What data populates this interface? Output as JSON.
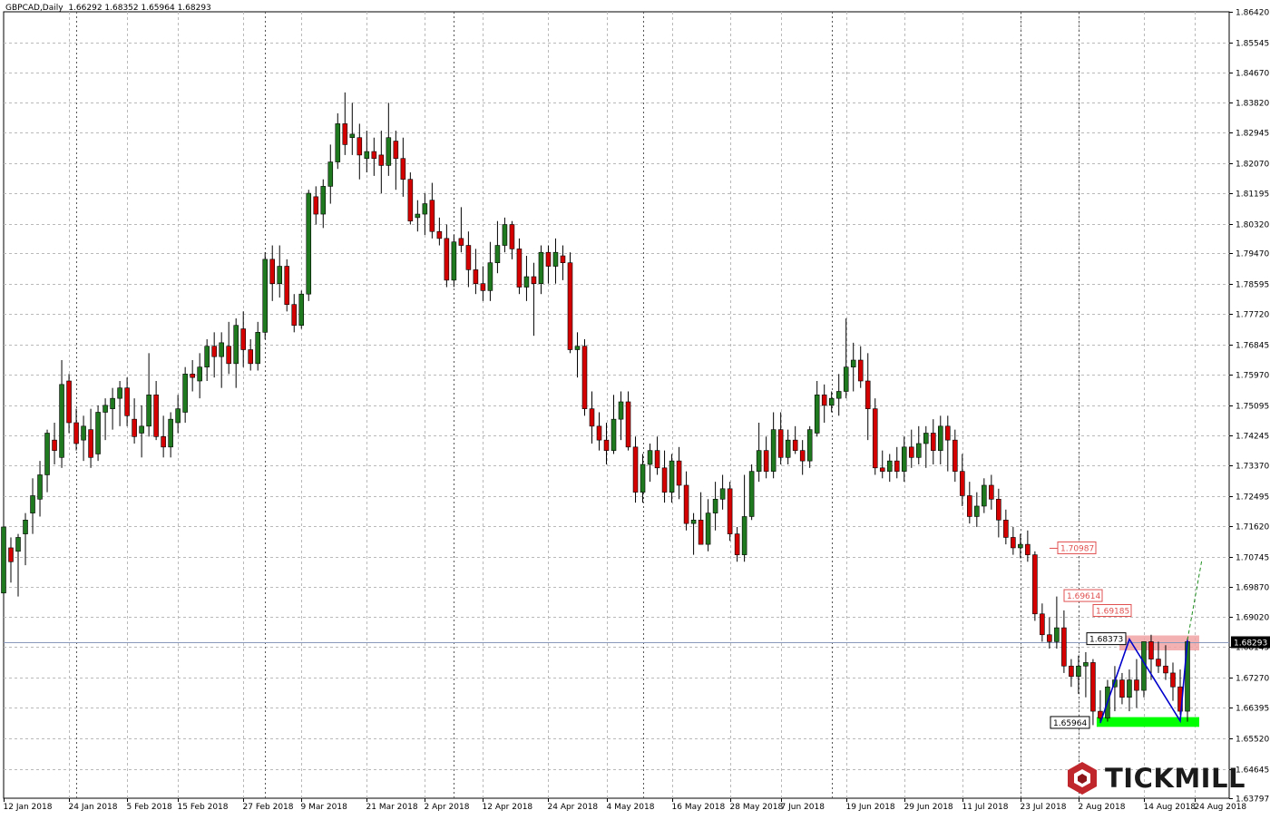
{
  "header": {
    "symbol": "GBPCAD,Daily",
    "ohlc": "1.66292 1.68352 1.65964 1.68293"
  },
  "logo": {
    "text": "TICKMILL",
    "icon": "hexagon-logo-icon",
    "color": "#c0272d"
  },
  "colors": {
    "bull": "#1f7a1f",
    "bear": "#d40000",
    "grid": "#b9b9b9",
    "support": "#00ff00",
    "resistance": "#f2a3a3",
    "pattern": "#0000cc",
    "projection": "#1f8f1f",
    "price_line": "#8899bb",
    "label_red": "#e05050"
  },
  "chart_data": {
    "type": "candlestick",
    "title": "GBPCAD,Daily",
    "ylim": [
      1.63797,
      1.8642
    ],
    "grid": true,
    "y_ticks": [
      "1.86420",
      "1.85545",
      "1.84670",
      "1.83820",
      "1.82945",
      "1.82070",
      "1.81195",
      "1.80320",
      "1.79470",
      "1.78595",
      "1.77720",
      "1.76845",
      "1.75970",
      "1.75095",
      "1.74245",
      "1.73370",
      "1.72495",
      "1.71620",
      "1.70745",
      "1.69870",
      "1.69020",
      "1.68145",
      "1.67270",
      "1.66395",
      "1.65520",
      "1.64645",
      "1.63797"
    ],
    "x_labels": [
      "12 Jan 2018",
      "24 Jan 2018",
      "5 Feb 2018",
      "15 Feb 2018",
      "27 Feb 2018",
      "9 Mar 2018",
      "21 Mar 2018",
      "2 Apr 2018",
      "12 Apr 2018",
      "24 Apr 2018",
      "4 May 2018",
      "16 May 2018",
      "28 May 2018",
      "7 Jun 2018",
      "19 Jun 2018",
      "29 Jun 2018",
      "11 Jul 2018",
      "23 Jul 2018",
      "2 Aug 2018",
      "14 Aug 2018",
      "24 Aug 2018"
    ],
    "candles": [
      [
        1.697,
        1.717,
        1.694,
        1.716
      ],
      [
        1.71,
        1.713,
        1.7,
        1.706
      ],
      [
        1.709,
        1.714,
        1.696,
        1.713
      ],
      [
        1.714,
        1.72,
        1.705,
        1.718
      ],
      [
        1.72,
        1.73,
        1.714,
        1.725
      ],
      [
        1.724,
        1.735,
        1.719,
        1.731
      ],
      [
        1.731,
        1.744,
        1.726,
        1.743
      ],
      [
        1.741,
        1.746,
        1.734,
        1.738
      ],
      [
        1.736,
        1.764,
        1.733,
        1.757
      ],
      [
        1.758,
        1.76,
        1.743,
        1.746
      ],
      [
        1.746,
        1.75,
        1.738,
        1.74
      ],
      [
        1.741,
        1.748,
        1.735,
        1.745
      ],
      [
        1.744,
        1.75,
        1.733,
        1.736
      ],
      [
        1.737,
        1.751,
        1.735,
        1.749
      ],
      [
        1.749,
        1.753,
        1.741,
        1.751
      ],
      [
        1.75,
        1.756,
        1.744,
        1.753
      ],
      [
        1.753,
        1.758,
        1.745,
        1.756
      ],
      [
        1.756,
        1.759,
        1.745,
        1.748
      ],
      [
        1.747,
        1.753,
        1.74,
        1.742
      ],
      [
        1.743,
        1.751,
        1.736,
        1.745
      ],
      [
        1.745,
        1.766,
        1.742,
        1.754
      ],
      [
        1.754,
        1.758,
        1.741,
        1.742
      ],
      [
        1.742,
        1.748,
        1.736,
        1.739
      ],
      [
        1.739,
        1.749,
        1.736,
        1.747
      ],
      [
        1.746,
        1.754,
        1.743,
        1.75
      ],
      [
        1.749,
        1.762,
        1.746,
        1.76
      ],
      [
        1.76,
        1.764,
        1.755,
        1.759
      ],
      [
        1.758,
        1.766,
        1.753,
        1.762
      ],
      [
        1.762,
        1.77,
        1.758,
        1.768
      ],
      [
        1.768,
        1.772,
        1.759,
        1.765
      ],
      [
        1.765,
        1.772,
        1.756,
        1.769
      ],
      [
        1.768,
        1.775,
        1.76,
        1.763
      ],
      [
        1.763,
        1.776,
        1.756,
        1.774
      ],
      [
        1.773,
        1.778,
        1.762,
        1.767
      ],
      [
        1.767,
        1.77,
        1.761,
        1.763
      ],
      [
        1.763,
        1.775,
        1.761,
        1.772
      ],
      [
        1.772,
        1.795,
        1.77,
        1.793
      ],
      [
        1.793,
        1.797,
        1.781,
        1.786
      ],
      [
        1.786,
        1.797,
        1.782,
        1.791
      ],
      [
        1.791,
        1.793,
        1.778,
        1.78
      ],
      [
        1.78,
        1.783,
        1.772,
        1.774
      ],
      [
        1.774,
        1.784,
        1.773,
        1.783
      ],
      [
        1.783,
        1.813,
        1.781,
        1.812
      ],
      [
        1.811,
        1.814,
        1.803,
        1.806
      ],
      [
        1.806,
        1.816,
        1.802,
        1.814
      ],
      [
        1.814,
        1.826,
        1.809,
        1.821
      ],
      [
        1.821,
        1.835,
        1.819,
        1.832
      ],
      [
        1.832,
        1.841,
        1.823,
        1.826
      ],
      [
        1.828,
        1.838,
        1.823,
        1.829
      ],
      [
        1.828,
        1.832,
        1.816,
        1.823
      ],
      [
        1.822,
        1.83,
        1.818,
        1.824
      ],
      [
        1.824,
        1.828,
        1.817,
        1.822
      ],
      [
        1.823,
        1.83,
        1.812,
        1.82
      ],
      [
        1.82,
        1.838,
        1.817,
        1.828
      ],
      [
        1.827,
        1.83,
        1.813,
        1.822
      ],
      [
        1.822,
        1.828,
        1.811,
        1.816
      ],
      [
        1.816,
        1.818,
        1.803,
        1.804
      ],
      [
        1.805,
        1.81,
        1.801,
        1.806
      ],
      [
        1.806,
        1.812,
        1.8,
        1.809
      ],
      [
        1.81,
        1.815,
        1.799,
        1.801
      ],
      [
        1.801,
        1.805,
        1.797,
        1.799
      ],
      [
        1.799,
        1.803,
        1.785,
        1.787
      ],
      [
        1.787,
        1.8,
        1.785,
        1.798
      ],
      [
        1.799,
        1.808,
        1.795,
        1.797
      ],
      [
        1.797,
        1.801,
        1.785,
        1.79
      ],
      [
        1.79,
        1.796,
        1.783,
        1.786
      ],
      [
        1.786,
        1.791,
        1.781,
        1.784
      ],
      [
        1.784,
        1.798,
        1.781,
        1.792
      ],
      [
        1.792,
        1.804,
        1.789,
        1.797
      ],
      [
        1.797,
        1.805,
        1.795,
        1.803
      ],
      [
        1.803,
        1.804,
        1.793,
        1.796
      ],
      [
        1.796,
        1.799,
        1.783,
        1.785
      ],
      [
        1.785,
        1.794,
        1.781,
        1.788
      ],
      [
        1.788,
        1.792,
        1.771,
        1.786
      ],
      [
        1.786,
        1.797,
        1.783,
        1.795
      ],
      [
        1.795,
        1.797,
        1.786,
        1.791
      ],
      [
        1.791,
        1.799,
        1.786,
        1.795
      ],
      [
        1.794,
        1.797,
        1.787,
        1.792
      ],
      [
        1.792,
        1.795,
        1.766,
        1.767
      ],
      [
        1.767,
        1.772,
        1.759,
        1.768
      ],
      [
        1.768,
        1.77,
        1.748,
        1.75
      ],
      [
        1.75,
        1.755,
        1.74,
        1.745
      ],
      [
        1.745,
        1.749,
        1.738,
        1.741
      ],
      [
        1.741,
        1.746,
        1.734,
        1.738
      ],
      [
        1.738,
        1.754,
        1.737,
        1.747
      ],
      [
        1.747,
        1.755,
        1.741,
        1.752
      ],
      [
        1.752,
        1.755,
        1.738,
        1.739
      ],
      [
        1.739,
        1.742,
        1.723,
        1.726
      ],
      [
        1.726,
        1.737,
        1.723,
        1.734
      ],
      [
        1.734,
        1.74,
        1.729,
        1.738
      ],
      [
        1.738,
        1.742,
        1.731,
        1.733
      ],
      [
        1.733,
        1.738,
        1.723,
        1.726
      ],
      [
        1.726,
        1.737,
        1.723,
        1.735
      ],
      [
        1.735,
        1.739,
        1.724,
        1.728
      ],
      [
        1.728,
        1.732,
        1.715,
        1.717
      ],
      [
        1.717,
        1.72,
        1.708,
        1.718
      ],
      [
        1.718,
        1.726,
        1.711,
        1.711
      ],
      [
        1.711,
        1.724,
        1.709,
        1.72
      ],
      [
        1.72,
        1.729,
        1.715,
        1.724
      ],
      [
        1.724,
        1.731,
        1.721,
        1.727
      ],
      [
        1.727,
        1.729,
        1.712,
        1.714
      ],
      [
        1.714,
        1.716,
        1.706,
        1.708
      ],
      [
        1.708,
        1.731,
        1.706,
        1.719
      ],
      [
        1.719,
        1.734,
        1.718,
        1.732
      ],
      [
        1.732,
        1.746,
        1.729,
        1.738
      ],
      [
        1.738,
        1.742,
        1.73,
        1.732
      ],
      [
        1.732,
        1.749,
        1.73,
        1.744
      ],
      [
        1.744,
        1.749,
        1.734,
        1.736
      ],
      [
        1.736,
        1.744,
        1.734,
        1.741
      ],
      [
        1.741,
        1.745,
        1.737,
        1.738
      ],
      [
        1.738,
        1.741,
        1.731,
        1.735
      ],
      [
        1.735,
        1.745,
        1.733,
        1.744
      ],
      [
        1.743,
        1.758,
        1.742,
        1.754
      ],
      [
        1.754,
        1.757,
        1.746,
        1.751
      ],
      [
        1.751,
        1.755,
        1.749,
        1.753
      ],
      [
        1.753,
        1.76,
        1.748,
        1.755
      ],
      [
        1.755,
        1.776,
        1.753,
        1.762
      ],
      [
        1.762,
        1.769,
        1.755,
        1.764
      ],
      [
        1.764,
        1.768,
        1.756,
        1.758
      ],
      [
        1.758,
        1.766,
        1.741,
        1.75
      ],
      [
        1.75,
        1.753,
        1.731,
        1.733
      ],
      [
        1.733,
        1.738,
        1.73,
        1.732
      ],
      [
        1.732,
        1.737,
        1.729,
        1.735
      ],
      [
        1.735,
        1.739,
        1.73,
        1.732
      ],
      [
        1.732,
        1.742,
        1.729,
        1.739
      ],
      [
        1.739,
        1.744,
        1.733,
        1.736
      ],
      [
        1.736,
        1.745,
        1.734,
        1.74
      ],
      [
        1.74,
        1.745,
        1.733,
        1.743
      ],
      [
        1.743,
        1.747,
        1.734,
        1.738
      ],
      [
        1.738,
        1.748,
        1.734,
        1.745
      ],
      [
        1.745,
        1.748,
        1.732,
        1.741
      ],
      [
        1.741,
        1.744,
        1.729,
        1.732
      ],
      [
        1.732,
        1.737,
        1.722,
        1.725
      ],
      [
        1.725,
        1.729,
        1.717,
        1.719
      ],
      [
        1.719,
        1.726,
        1.716,
        1.722
      ],
      [
        1.722,
        1.73,
        1.72,
        1.728
      ],
      [
        1.728,
        1.731,
        1.721,
        1.724
      ],
      [
        1.724,
        1.727,
        1.713,
        1.718
      ],
      [
        1.718,
        1.721,
        1.711,
        1.713
      ],
      [
        1.713,
        1.716,
        1.708,
        1.71
      ],
      [
        1.71,
        1.714,
        1.707,
        1.711
      ],
      [
        1.711,
        1.715,
        1.706,
        1.708
      ],
      [
        1.708,
        1.709,
        1.689,
        1.691
      ],
      [
        1.691,
        1.694,
        1.683,
        1.685
      ],
      [
        1.685,
        1.69,
        1.681,
        1.683
      ],
      [
        1.683,
        1.696,
        1.681,
        1.687
      ],
      [
        1.687,
        1.692,
        1.674,
        1.676
      ],
      [
        1.676,
        1.678,
        1.67,
        1.673
      ],
      [
        1.673,
        1.679,
        1.668,
        1.676
      ],
      [
        1.676,
        1.68,
        1.667,
        1.677
      ],
      [
        1.677,
        1.678,
        1.659,
        1.663
      ],
      [
        1.663,
        1.669,
        1.66,
        1.661
      ],
      [
        1.661,
        1.672,
        1.66,
        1.67
      ],
      [
        1.67,
        1.676,
        1.663,
        1.672
      ],
      [
        1.672,
        1.674,
        1.665,
        1.667
      ],
      [
        1.667,
        1.675,
        1.663,
        1.672
      ],
      [
        1.672,
        1.678,
        1.664,
        1.669
      ],
      [
        1.669,
        1.683,
        1.667,
        1.683
      ],
      [
        1.683,
        1.685,
        1.672,
        1.678
      ],
      [
        1.678,
        1.683,
        1.674,
        1.676
      ],
      [
        1.676,
        1.682,
        1.672,
        1.674
      ],
      [
        1.674,
        1.677,
        1.666,
        1.67
      ],
      [
        1.67,
        1.675,
        1.662,
        1.663
      ],
      [
        1.663,
        1.684,
        1.66,
        1.683
      ]
    ],
    "annotations": {
      "price_labels_red": [
        {
          "text": "1.70987",
          "value": 1.70987
        },
        {
          "text": "1.69614",
          "value": 1.69614
        },
        {
          "text": "1.69185",
          "value": 1.69185
        }
      ],
      "high_label": {
        "text": "1.68373",
        "value": 1.68373
      },
      "low_label": {
        "text": "1.65964",
        "value": 1.65964
      },
      "current_price": {
        "text": "1.68293",
        "value": 1.68293
      },
      "resistance_zone": [
        1.6805,
        1.6848
      ],
      "support_zone": [
        1.6585,
        1.6613
      ],
      "double_bottom_points": [
        1.6596,
        1.6837,
        1.6602,
        1.6835
      ],
      "projection_target": 1.7067
    }
  }
}
